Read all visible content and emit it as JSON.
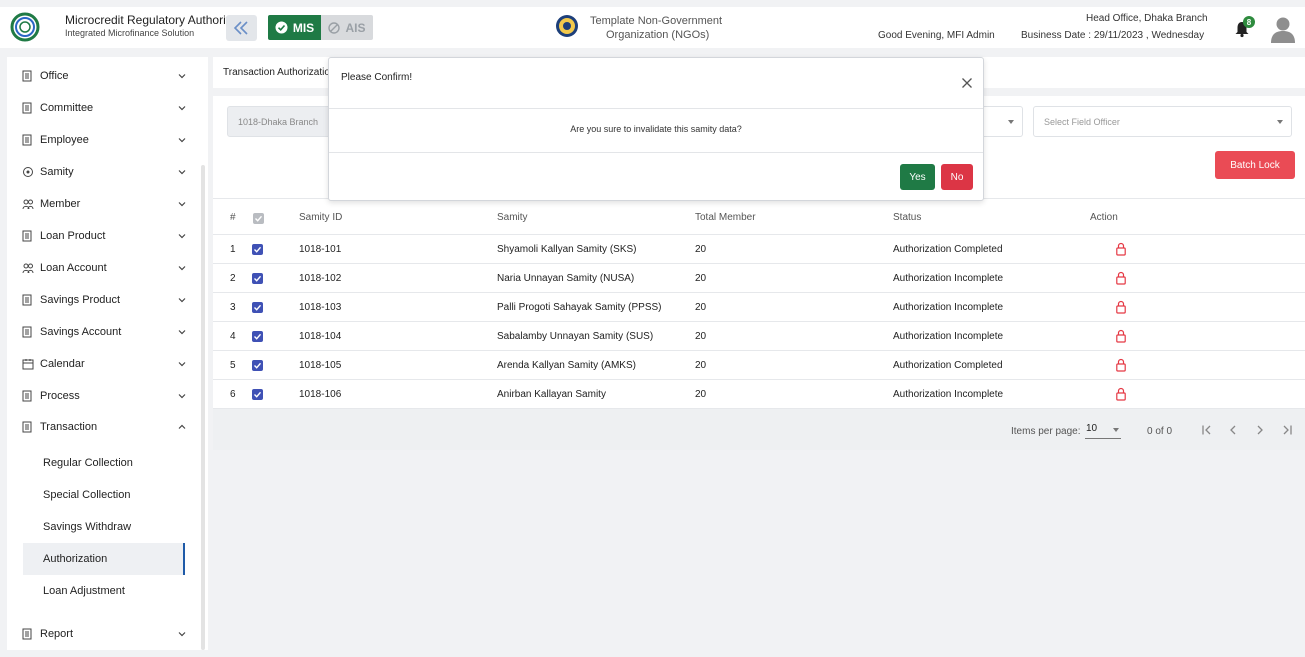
{
  "header": {
    "brand_title": "Microcredit Regulatory Authority",
    "brand_subtitle": "Integrated Microfinance Solution",
    "logo_text": "Microcredit Regulatory Authority",
    "mis_label": "MIS",
    "ais_label": "AIS",
    "org_line1": "Template Non-Government",
    "org_line2": "Organization (NGOs)",
    "greeting": "Good Evening, MFI Admin",
    "office": "Head Office, Dhaka Branch",
    "business_date": "Business Date : 29/11/2023 , Wednesday",
    "notification_count": "8",
    "accent_green": "#1f7a45",
    "icons": [
      "double-chevron-left-icon",
      "check-circle-icon",
      "block-icon",
      "emblem-icon",
      "bell-icon",
      "user-avatar-icon"
    ]
  },
  "sidebar": {
    "items": [
      {
        "label": "Office",
        "icon": "office-icon",
        "expanded": false
      },
      {
        "label": "Committee",
        "icon": "committee-icon",
        "expanded": false
      },
      {
        "label": "Employee",
        "icon": "employee-icon",
        "expanded": false
      },
      {
        "label": "Samity",
        "icon": "samity-icon",
        "expanded": false
      },
      {
        "label": "Member",
        "icon": "member-icon",
        "expanded": false
      },
      {
        "label": "Loan Product",
        "icon": "loan-product-icon",
        "expanded": false
      },
      {
        "label": "Loan Account",
        "icon": "loan-account-icon",
        "expanded": false
      },
      {
        "label": "Savings Product",
        "icon": "savings-product-icon",
        "expanded": false
      },
      {
        "label": "Savings Account",
        "icon": "savings-account-icon",
        "expanded": false
      },
      {
        "label": "Calendar",
        "icon": "calendar-icon",
        "expanded": false
      },
      {
        "label": "Process",
        "icon": "process-icon",
        "expanded": false
      },
      {
        "label": "Transaction",
        "icon": "transaction-icon",
        "expanded": true
      }
    ],
    "subitems": [
      {
        "label": "Regular Collection",
        "active": false
      },
      {
        "label": "Special Collection",
        "active": false
      },
      {
        "label": "Savings Withdraw",
        "active": false
      },
      {
        "label": "Authorization",
        "active": true
      },
      {
        "label": "Loan Adjustment",
        "active": false
      }
    ],
    "report": {
      "label": "Report",
      "icon": "report-icon"
    }
  },
  "main": {
    "tab_label": "Transaction Authorization",
    "branch_value": "1018-Dhaka Branch",
    "field_officer_placeholder": "Select Field Officer",
    "batch_lock_label": "Batch Lock",
    "table": {
      "headers": [
        "#",
        "Samity ID",
        "Samity",
        "Total Member",
        "Status",
        "Action"
      ],
      "rows": [
        {
          "no": "1",
          "id": "1018-101",
          "samity": "Shyamoli Kallyan Samity (SKS)",
          "members": "20",
          "status": "Authorization Completed"
        },
        {
          "no": "2",
          "id": "1018-102",
          "samity": "Naria Unnayan Samity (NUSA)",
          "members": "20",
          "status": "Authorization Incomplete"
        },
        {
          "no": "3",
          "id": "1018-103",
          "samity": "Palli Progoti Sahayak Samity (PPSS)",
          "members": "20",
          "status": "Authorization Incomplete"
        },
        {
          "no": "4",
          "id": "1018-104",
          "samity": "Sabalamby Unnayan Samity (SUS)",
          "members": "20",
          "status": "Authorization Incomplete"
        },
        {
          "no": "5",
          "id": "1018-105",
          "samity": "Arenda Kallyan Samity (AMKS)",
          "members": "20",
          "status": "Authorization Completed"
        },
        {
          "no": "6",
          "id": "1018-106",
          "samity": "Anirban Kallayan Samity",
          "members": "20",
          "status": "Authorization Incomplete"
        }
      ]
    },
    "pager": {
      "items_per_page_label": "Items per page:",
      "items_per_page": "10",
      "range": "0 of 0"
    }
  },
  "modal": {
    "title": "Please Confirm!",
    "message": "Are you sure to invalidate this samity data?",
    "yes_label": "Yes",
    "no_label": "No"
  }
}
